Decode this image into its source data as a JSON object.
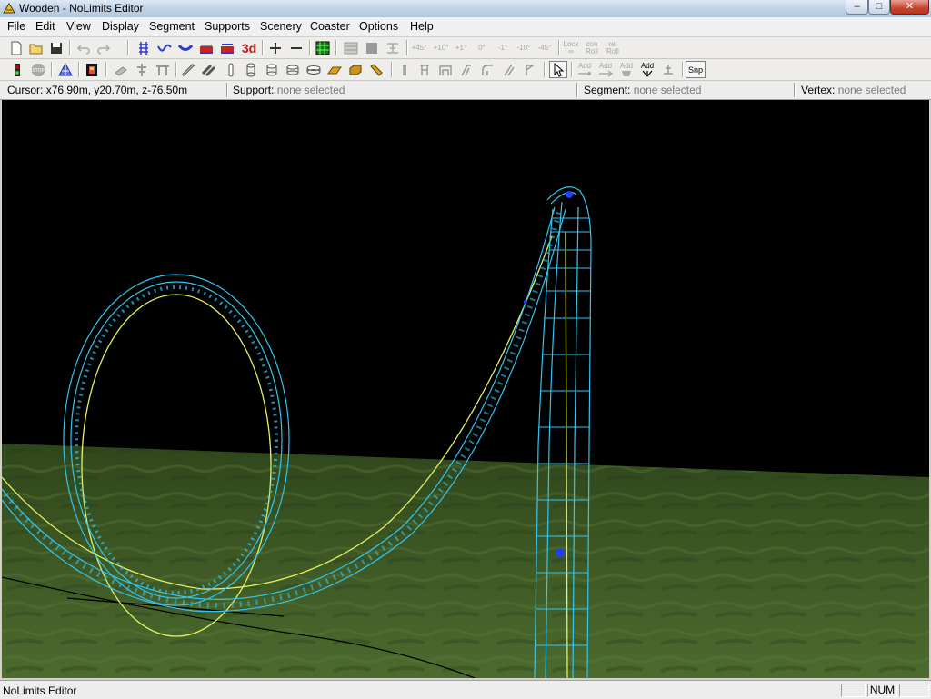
{
  "window": {
    "title": "Wooden - NoLimits Editor",
    "controls": {
      "minimize": "–",
      "maximize": "□",
      "close": "✕"
    }
  },
  "menu": [
    "File",
    "Edit",
    "View",
    "Display",
    "Segment",
    "Supports",
    "Scenery",
    "Coaster",
    "Options",
    "Help"
  ],
  "toolbar1": {
    "three_d_label": "3d",
    "angles": [
      "+45°",
      "+10°",
      "+1°",
      "0°",
      "-1°",
      "-10°",
      "-45°"
    ],
    "lock_label": [
      "Lock",
      "∞"
    ],
    "con_roll": [
      "con",
      "Roll"
    ],
    "rel_roll": [
      "rel",
      "Roll"
    ]
  },
  "toolbar2": {
    "stop_label": "STOP",
    "add_labels": [
      "Add",
      "Add",
      "Add",
      "Add"
    ],
    "snap_label": "Snp"
  },
  "infobar": {
    "cursor_label": "Cursor:",
    "cursor_value": "x76.90m, y20.70m, z-76.50m",
    "support_label": "Support:",
    "support_value": "none selected",
    "segment_label": "Segment:",
    "segment_value": "none selected",
    "vertex_label": "Vertex:",
    "vertex_value": "none selected"
  },
  "status": {
    "text": "NoLimits Editor",
    "num": "NUM"
  },
  "colors": {
    "track_wire": "#33c6f0",
    "heartline": "#e4f060",
    "vertex": "#1f40ff",
    "ground_dark": "#2f461b",
    "ground_light": "#4c6b2e"
  }
}
